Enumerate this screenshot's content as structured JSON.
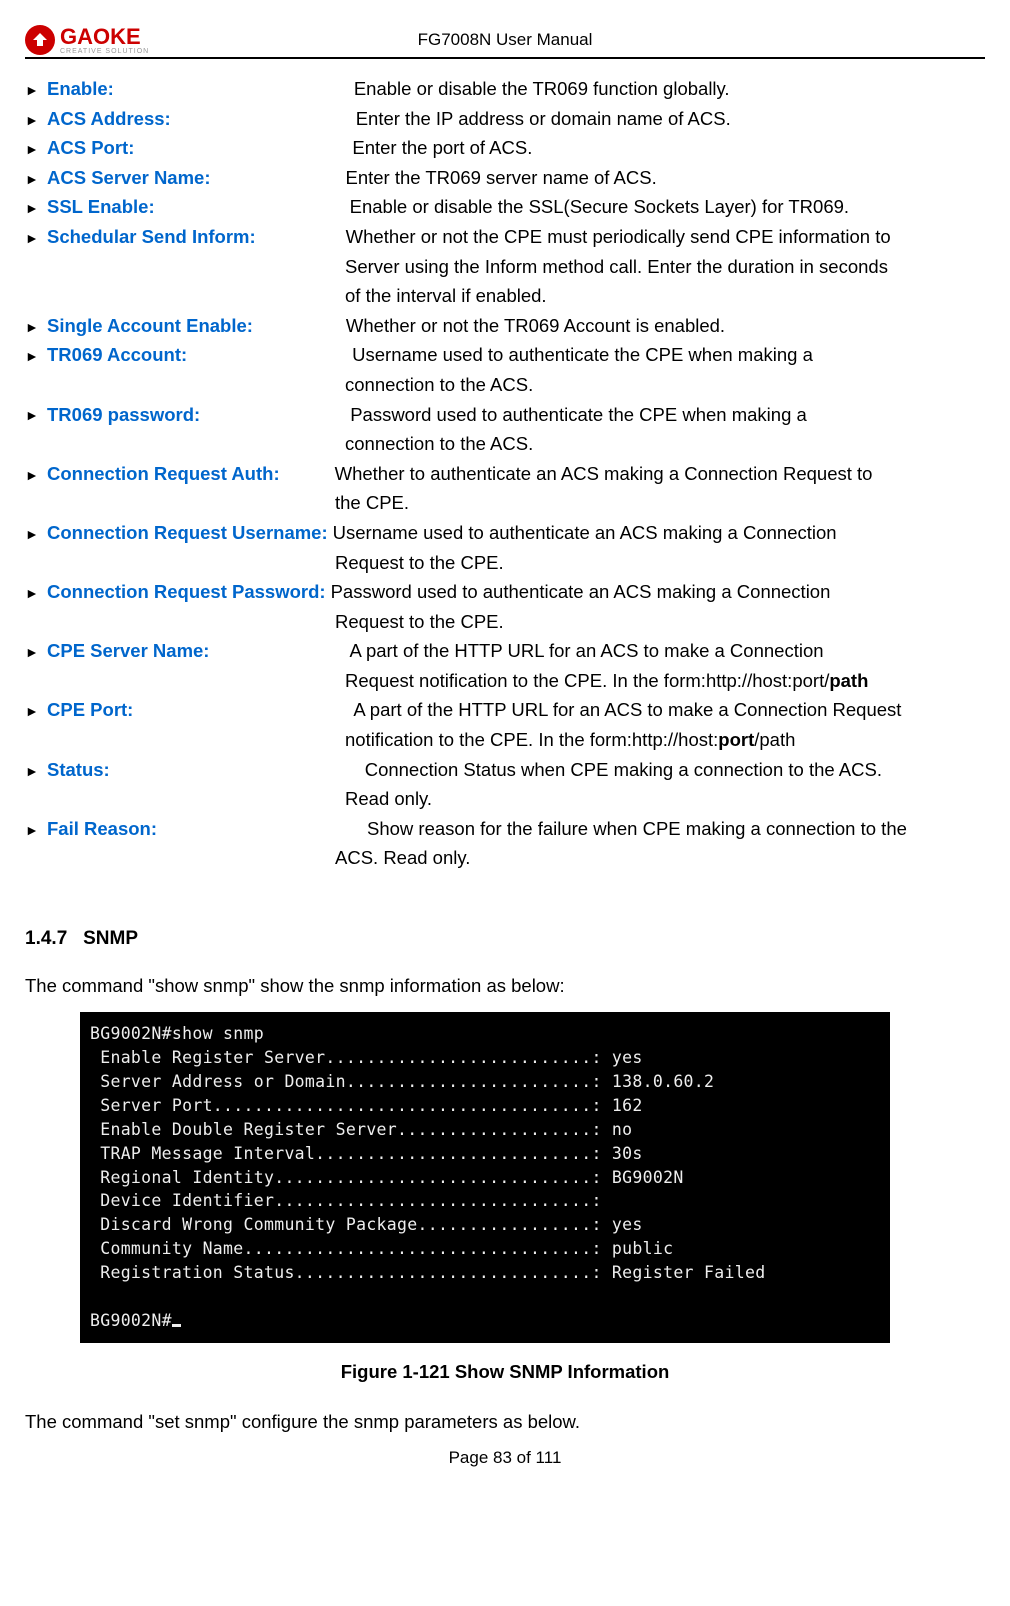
{
  "header": {
    "logo_main": "GAOKE",
    "logo_sub": "CREATIVE SOLUTION",
    "title": "FG7008N User Manual"
  },
  "definitions": [
    {
      "label": "Enable:",
      "desc": "Enable or disable the TR069 function globally.",
      "pad": 240
    },
    {
      "label": "ACS Address:",
      "desc": "Enter the IP address or domain name of ACS.",
      "pad": 185
    },
    {
      "label": "ACS Port:",
      "desc": "Enter the port of ACS.",
      "pad": 218
    },
    {
      "label": "ACS Server Name:",
      "desc": "Enter the TR069 server name of ACS.",
      "pad": 135
    },
    {
      "label": "SSL Enable:",
      "desc": "Enable or disable the SSL(Secure Sockets Layer) for TR069.",
      "pad": 195
    },
    {
      "label": "Schedular Send Inform:",
      "desc": "Whether or not the CPE must periodically send CPE information to",
      "pad": 90,
      "cont": [
        "Server using the Inform method call. Enter the duration in seconds",
        "of the interval if enabled."
      ]
    },
    {
      "label": "Single Account Enable:",
      "desc": "Whether or not the TR069 Account is enabled.",
      "pad": 93
    },
    {
      "label": "TR069 Account:",
      "desc": "Username used to authenticate the CPE when making a",
      "pad": 165,
      "cont": [
        "connection to the ACS."
      ]
    },
    {
      "label": "TR069 password:",
      "desc": "Password used to authenticate the CPE when making a",
      "pad": 150,
      "cont": [
        "connection to the ACS."
      ]
    },
    {
      "label": "Connection Request Auth:",
      "desc": "Whether to authenticate an ACS making a Connection Request to",
      "pad": 55,
      "cont": [
        "the CPE."
      ],
      "cont_pad": 310
    },
    {
      "label": "Connection Request Username:",
      "desc": "Username used to authenticate an ACS making a Connection",
      "pad": 5,
      "cont": [
        "Request to the CPE."
      ],
      "cont_pad": 310
    },
    {
      "label": "Connection Request Password:",
      "desc": "Password used to authenticate an ACS making a Connection",
      "pad": 5,
      "cont": [
        "Request to the CPE."
      ],
      "cont_pad": 310
    },
    {
      "label": "CPE Server Name:",
      "desc": "A part of the HTTP URL for an ACS to make a Connection",
      "pad": 140,
      "cont_html": [
        "Request notification to the CPE. In the form:http://host:port/<b>path</b>"
      ]
    },
    {
      "label": "CPE Port:",
      "desc": "A part of the HTTP URL for an ACS to make a Connection Request",
      "pad": 220,
      "cont_html": [
        "notification to the CPE. In the form:http://host:<b>port</b>/path"
      ]
    },
    {
      "label": "Status:",
      "desc": "Connection Status when CPE making a connection to the ACS.",
      "pad": 255,
      "cont": [
        "Read only."
      ]
    },
    {
      "label": "Fail Reason:",
      "desc": "Show reason for the failure when CPE making a connection to the",
      "pad": 210,
      "cont": [
        "ACS. Read only."
      ],
      "cont_pad": 310
    }
  ],
  "section": {
    "number": "1.4.7",
    "title": "SNMP",
    "intro": "The command \"show snmp\" show the snmp information as below:"
  },
  "terminal": {
    "prompt1": "BG9002N#show snmp",
    "lines": [
      {
        "k": "Enable Register Server",
        "v": "yes"
      },
      {
        "k": "Server Address or Domain",
        "v": "138.0.60.2"
      },
      {
        "k": "Server Port",
        "v": "162"
      },
      {
        "k": "Enable Double Register Server",
        "v": "no"
      },
      {
        "k": "TRAP Message Interval",
        "v": "30s"
      },
      {
        "k": "Regional Identity",
        "v": "BG9002N"
      },
      {
        "k": "Device Identifier",
        "v": ""
      },
      {
        "k": "Discard Wrong Community Package",
        "v": "yes"
      },
      {
        "k": "Community Name",
        "v": "public"
      },
      {
        "k": "Registration Status",
        "v": "Register Failed"
      }
    ],
    "prompt2": "BG9002N#",
    "dot_width": 49
  },
  "figure_caption": "Figure 1-121  Show SNMP Information",
  "outro": "The command \"set snmp\" configure the snmp parameters as below.",
  "footer": "Page 83 of 111"
}
